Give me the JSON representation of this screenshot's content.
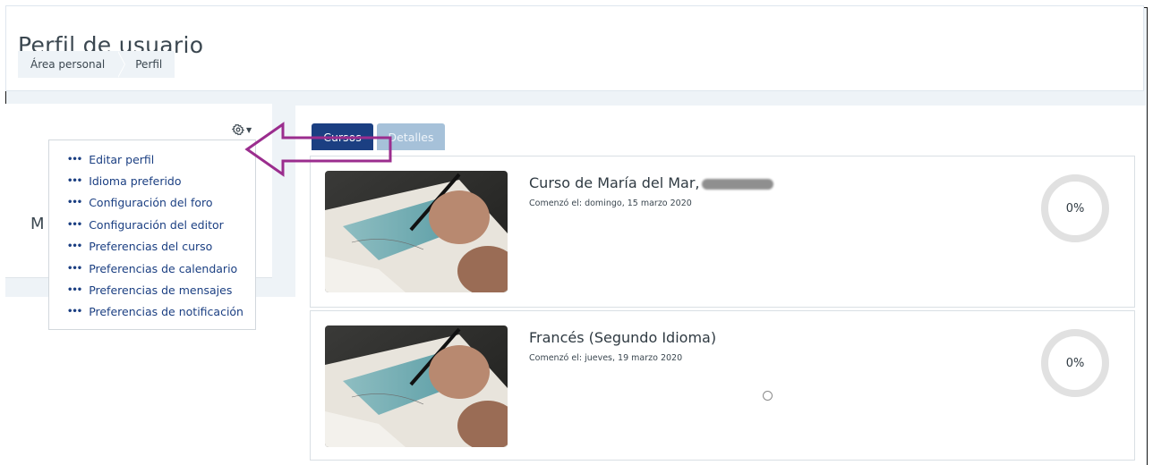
{
  "header": {
    "title": "Perfil de usuario",
    "breadcrumb": [
      "Área personal",
      "Perfil"
    ]
  },
  "profile": {
    "name_initial": "M"
  },
  "user_menu": {
    "icon": "gear-icon",
    "items": [
      "Editar perfil",
      "Idioma preferido",
      "Configuración del foro",
      "Configuración del editor",
      "Preferencias del curso",
      "Preferencias de calendario",
      "Preferencias de mensajes",
      "Preferencias de notificación"
    ]
  },
  "tabs": [
    {
      "label": "Cursos",
      "active": true
    },
    {
      "label": "Detalles",
      "active": false
    }
  ],
  "courses": [
    {
      "title": "Curso de María del Mar,",
      "started": "Comenzó el: domingo, 15 marzo 2020",
      "progress": "0%"
    },
    {
      "title": "Francés (Segundo Idioma)",
      "started": "Comenzó el: jueves, 19 marzo 2020",
      "progress": "0%"
    }
  ],
  "colors": {
    "primary": "#1b3f82",
    "tab_inactive": "#a6c1d9",
    "annotation_arrow": "#9b2d8e",
    "page_bg": "#eef3f7"
  }
}
